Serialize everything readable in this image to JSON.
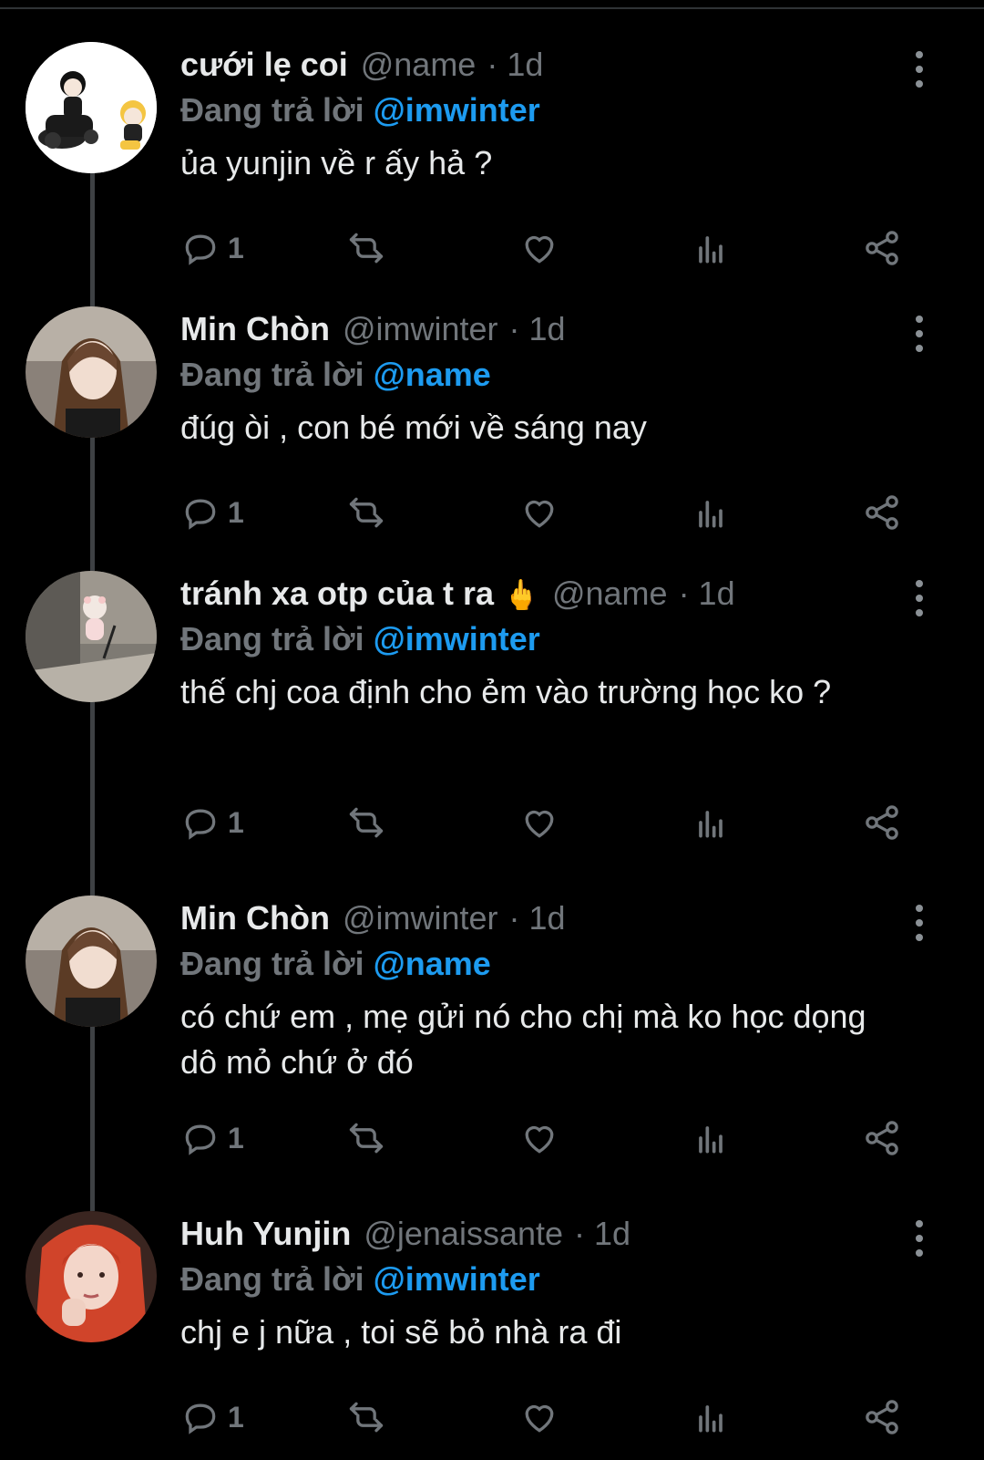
{
  "reply_prefix": "Đang trả lời",
  "tweets": [
    {
      "name": "cưới lẹ coi",
      "emoji": "",
      "handle": "@name",
      "time": "· 1d",
      "reply_to": "@imwinter",
      "text": "ủa yunjin về r ấy hả ?",
      "reply_count": "1"
    },
    {
      "name": "Min Chòn",
      "emoji": "",
      "handle": "@imwinter",
      "time": "· 1d",
      "reply_to": "@name",
      "text": "đúg òi , con bé mới về sáng nay",
      "reply_count": "1"
    },
    {
      "name": "tránh xa otp của t ra",
      "emoji": "🖕",
      "handle": "@name",
      "time": "· 1d",
      "reply_to": "@imwinter",
      "text": "thế chj coa định cho ẻm vào trường học ko ?",
      "reply_count": "1"
    },
    {
      "name": "Min Chòn",
      "emoji": "",
      "handle": "@imwinter",
      "time": "· 1d",
      "reply_to": "@name",
      "text": "có chứ em , mẹ gửi nó cho chị mà ko học dọng dô mỏ chứ ở đó",
      "reply_count": "1"
    },
    {
      "name": "Huh Yunjin",
      "emoji": "",
      "handle": "@jenaissante",
      "time": "· 1d",
      "reply_to": "@imwinter",
      "text": "chj e j nữa , toi sẽ bỏ nhà ra đi",
      "reply_count": "1"
    }
  ],
  "icons": {
    "reply": "reply-icon",
    "retweet": "retweet-icon",
    "like": "heart-icon",
    "views": "views-icon",
    "share": "share-icon",
    "more": "more-icon"
  },
  "colors": {
    "background": "#000000",
    "text": "#e7e9ea",
    "muted": "#71767b",
    "mention": "#1d9bf0",
    "thread_line": "#3e4144"
  }
}
